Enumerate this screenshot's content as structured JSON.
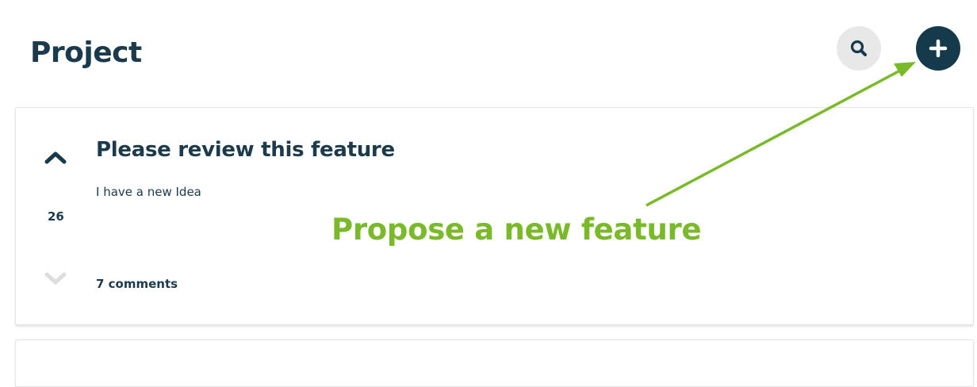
{
  "header": {
    "title": "Project",
    "search_icon": "search-icon",
    "add_icon": "plus-icon"
  },
  "post": {
    "title": "Please review this feature",
    "description": "I have a new Idea",
    "votes": "26",
    "comments": "7 comments",
    "upvote_icon": "chevron-up-icon",
    "downvote_icon": "chevron-down-icon"
  },
  "annotation": {
    "text": "Propose a new feature",
    "color": "#7ab929"
  },
  "colors": {
    "primary": "#153a4c",
    "text": "#1b3a4b",
    "search_bg": "#e8e8e8",
    "muted": "#dddddd"
  }
}
